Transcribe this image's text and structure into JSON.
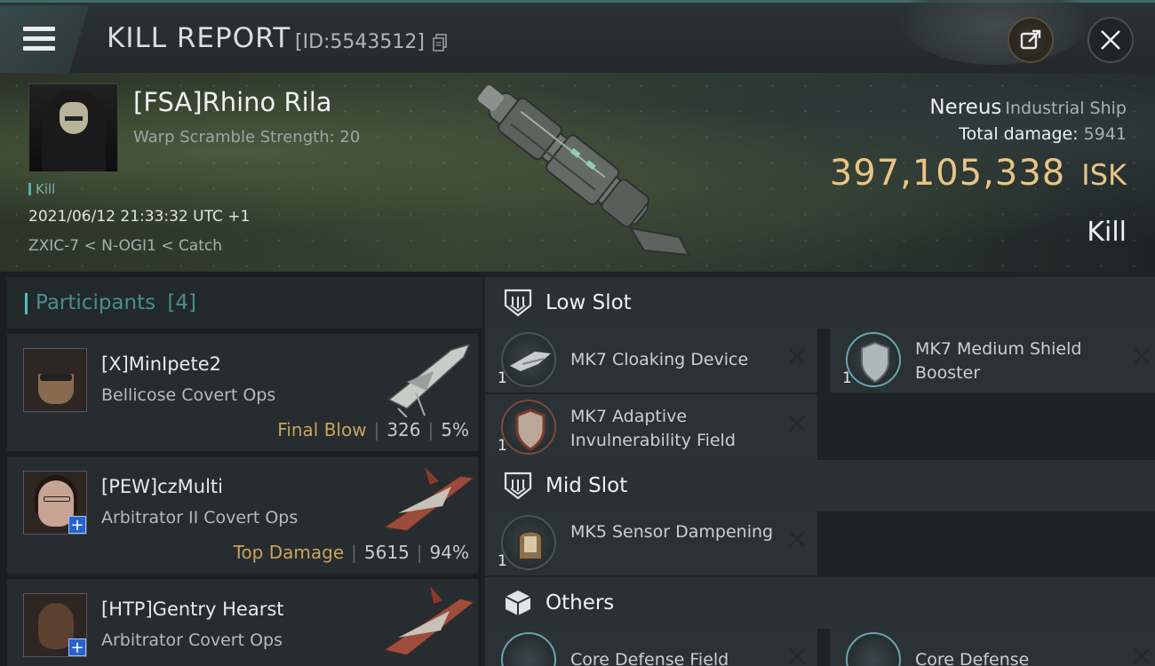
{
  "header": {
    "title": "KILL REPORT",
    "report_id": "[ID:5543512]",
    "menu_icon": "hamburger-icon",
    "share_icon": "share-icon",
    "close_icon": "close-icon"
  },
  "victim": {
    "name": "[FSA]Rhino Rila",
    "subtitle": "Warp Scramble Strength: 20",
    "tag": "Kill",
    "time": "2021/06/12 21:33:32 UTC +1",
    "location": "ZXIC-7 < N-OGI1 < Catch",
    "ship_name": "Nereus",
    "ship_type": "Industrial Ship",
    "damage_label": "Total damage:",
    "total_damage": "5941",
    "isk_value": "397,105,338",
    "isk_unit": "ISK",
    "result": "Kill"
  },
  "participants": {
    "header": "Participants",
    "count": "[4]",
    "items": [
      {
        "name": "[X]MinIpete2",
        "ship": "Bellicose Covert Ops",
        "tag": "Final Blow",
        "damage": "326",
        "percent": "5%"
      },
      {
        "name": "[PEW]czMulti",
        "ship": "Arbitrator II Covert Ops",
        "tag": "Top Damage",
        "damage": "5615",
        "percent": "94%"
      },
      {
        "name": "[HTP]Gentry Hearst",
        "ship": "Arbitrator Covert Ops",
        "tag": "",
        "damage": "",
        "percent": ""
      }
    ]
  },
  "fitting": {
    "low_slot": "Low Slot",
    "mid_slot": "Mid Slot",
    "others": "Others",
    "modules": [
      {
        "name": "MK7 Cloaking Device",
        "qty": "1"
      },
      {
        "name": "MK7 Medium Shield Booster",
        "qty": "1"
      },
      {
        "name": "MK7 Adaptive Invulnerability Field",
        "qty": "1"
      },
      {
        "name": "MK5 Sensor Dampening",
        "qty": "1"
      },
      {
        "name": "Core Defense Field",
        "qty": ""
      },
      {
        "name": "Core Defense",
        "qty": ""
      }
    ]
  },
  "colors": {
    "accent_teal": "#4fb0b0",
    "isk_gold": "#e8c585",
    "tag_gold": "#c9a25a"
  }
}
